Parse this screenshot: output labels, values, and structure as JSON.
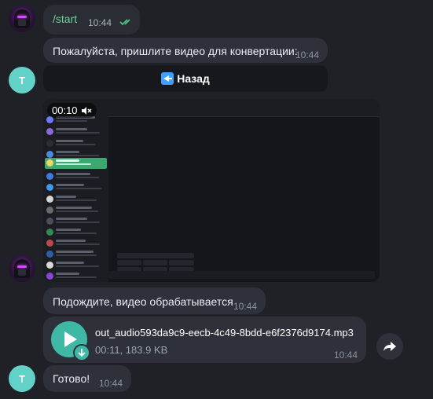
{
  "messages": {
    "start": {
      "text": "/start",
      "time": "10:44"
    },
    "prompt": {
      "text": "Пожалуйста, пришлите видео для конвертации:",
      "time": "10:44"
    },
    "keyboard": {
      "back_label": "Назад"
    },
    "video": {
      "duration": "00:10"
    },
    "processing": {
      "text": "Подождите, видео обрабатывается",
      "time": "10:44"
    },
    "audio": {
      "filename": "out_audio593da9c9-eecb-4c49-8bdd-e6f2376d9174.mp3",
      "meta": "00:11, 183.9 KB",
      "time": "10:44"
    },
    "done": {
      "text": "Готово!",
      "time": "10:44"
    }
  },
  "avatars": {
    "bot_initial": "T"
  },
  "colors": {
    "background": "#1f2126",
    "bubble_in": "#2e3139",
    "accent": "#3fb8a6",
    "avatar_bot": "#62d2c8",
    "start_text": "#6fd0a0"
  },
  "icons": {
    "read_ticks": "double-check-icon",
    "back": "back-arrow-icon",
    "mute": "speaker-mute-icon",
    "play": "play-icon",
    "download": "download-icon",
    "forward": "forward-share-icon"
  }
}
